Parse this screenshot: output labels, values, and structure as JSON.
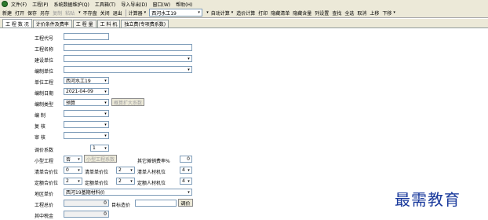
{
  "menubar": {
    "items": [
      "文件(F)",
      "工程(P)",
      "系统数据维护(Q)",
      "工具箱(T)",
      "导入导出(D)",
      "窗口(W)",
      "帮助(H)"
    ]
  },
  "toolbar": {
    "items": [
      {
        "label": "新建",
        "disabled": false
      },
      {
        "label": "打开",
        "disabled": false
      },
      {
        "label": "保存",
        "disabled": false
      },
      {
        "label": "另存",
        "disabled": false
      },
      {
        "label": "复制",
        "disabled": true
      },
      {
        "label": "粘贴",
        "disabled": true
      },
      {
        "label": "不存盘",
        "disabled": false
      },
      {
        "label": "关闭",
        "disabled": false
      },
      {
        "label": "退出",
        "disabled": false
      }
    ],
    "calc_menu": "计算器",
    "region_combo": "西河水工19",
    "auto_calc": "自动计算",
    "right_items": [
      "造价计算",
      "打印",
      "隐藏清单",
      "隐藏含量",
      "列设置",
      "查找",
      "全选",
      "取消",
      "上移",
      "下移"
    ]
  },
  "tabs": [
    "工 程 数 况",
    "计价条件及费率",
    "工 程 量",
    "工 料 机",
    "独立费(专项费系数)"
  ],
  "form": {
    "project_code_label": "工程代号",
    "project_code": "",
    "project_name_label": "工程名称",
    "project_name": "",
    "build_unit_label": "建设单位",
    "build_unit": "",
    "compile_unit_label": "编制单位",
    "compile_unit": "",
    "unit_project_label": "单位工程",
    "unit_project": "西河水工19",
    "compile_date_label": "编制日期",
    "compile_date": "2021-04-09",
    "compile_type_label": "编制类型",
    "compile_type": "预算",
    "expand_coef_button": "概算扩大系数",
    "compiler_label": "编 制",
    "compiler": "",
    "reviewer_label": "复 核",
    "reviewer": "",
    "auditor_label": "审 核",
    "auditor": "",
    "price_coef_label": "调价系数",
    "price_coef": "1",
    "small_project_label": "小型工程",
    "small_project": "否",
    "small_project_coef_button": "小型工程系数",
    "other_fee_rate_label": "其它摊销费率%",
    "other_fee_rate": "0",
    "list_precision_label": "清单合价位",
    "list_precision": "0",
    "list_unit_price_label": "清单单价位",
    "list_unit_price": "2",
    "list_labor_label": "清单人材机位",
    "list_labor": "4",
    "quota_precision_label": "定额合价位",
    "quota_precision": "2",
    "quota_unit_price_label": "定额单价位",
    "quota_unit_price": "2",
    "quota_labor_label": "定额人材机位",
    "quota_labor": "4",
    "region_price_label": "地区单价",
    "region_price": "西河19基期材料价",
    "total_cost_label": "工程总价",
    "total_cost": "0",
    "target_cost_label": "目标造价",
    "target_cost": "",
    "adjust_button": "调价",
    "tax_label": "其中税金",
    "tax": "0"
  },
  "watermark": "最需教育"
}
